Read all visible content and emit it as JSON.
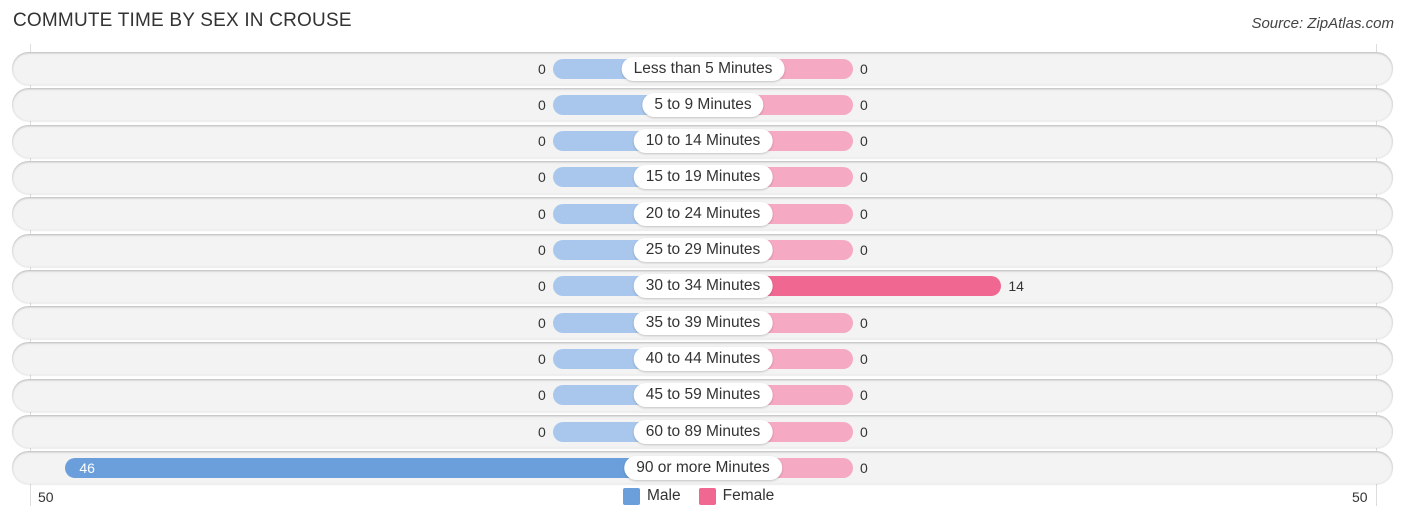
{
  "title": "COMMUTE TIME BY SEX IN CROUSE",
  "source": "Source: ZipAtlas.com",
  "colors": {
    "male": "#a9c7ec",
    "male_strong": "#6a9fdb",
    "female": "#f5a9c2",
    "female_strong": "#f06792"
  },
  "chart_data": {
    "type": "bar",
    "orientation": "horizontal-diverging",
    "title": "COMMUTE TIME BY SEX IN CROUSE",
    "categories": [
      "Less than 5 Minutes",
      "5 to 9 Minutes",
      "10 to 14 Minutes",
      "15 to 19 Minutes",
      "20 to 24 Minutes",
      "25 to 29 Minutes",
      "30 to 34 Minutes",
      "35 to 39 Minutes",
      "40 to 44 Minutes",
      "45 to 59 Minutes",
      "60 to 89 Minutes",
      "90 or more Minutes"
    ],
    "series": [
      {
        "name": "Male",
        "values": [
          0,
          0,
          0,
          0,
          0,
          0,
          0,
          0,
          0,
          0,
          0,
          46
        ]
      },
      {
        "name": "Female",
        "values": [
          0,
          0,
          0,
          0,
          0,
          0,
          14,
          0,
          0,
          0,
          0,
          0
        ]
      }
    ],
    "axis": {
      "left_label": "50",
      "right_label": "50",
      "range": [
        0,
        50
      ]
    },
    "legend": {
      "entries": [
        "Male",
        "Female"
      ],
      "placement": "bottom-center"
    }
  }
}
